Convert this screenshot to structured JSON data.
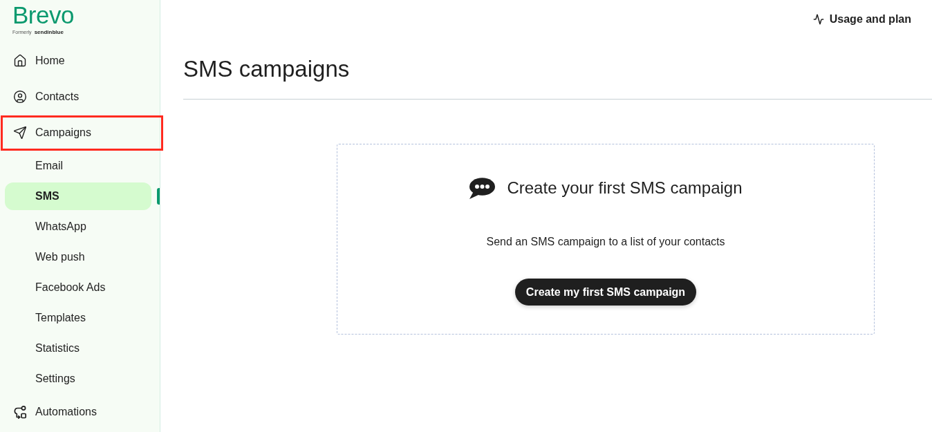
{
  "logo": {
    "wordmark": "Brevo",
    "formerly": "Formerly",
    "former_name": "sendinblue"
  },
  "sidebar": {
    "items": [
      {
        "label": "Home",
        "selected": false,
        "highlighted": false
      },
      {
        "label": "Contacts",
        "selected": false,
        "highlighted": false
      },
      {
        "label": "Campaigns",
        "selected": false,
        "highlighted": true,
        "children": [
          {
            "label": "Email",
            "selected": false
          },
          {
            "label": "SMS",
            "selected": true
          },
          {
            "label": "WhatsApp",
            "selected": false
          },
          {
            "label": "Web push",
            "selected": false
          },
          {
            "label": "Facebook Ads",
            "selected": false
          },
          {
            "label": "Templates",
            "selected": false
          },
          {
            "label": "Statistics",
            "selected": false
          },
          {
            "label": "Settings",
            "selected": false
          }
        ]
      },
      {
        "label": "Automations",
        "selected": false,
        "highlighted": false
      }
    ]
  },
  "header": {
    "usage_link": "Usage and plan"
  },
  "page": {
    "title": "SMS campaigns",
    "empty_state": {
      "title": "Create your first SMS campaign",
      "description": "Send an SMS campaign to a list of your contacts",
      "button": "Create my first SMS campaign"
    }
  }
}
